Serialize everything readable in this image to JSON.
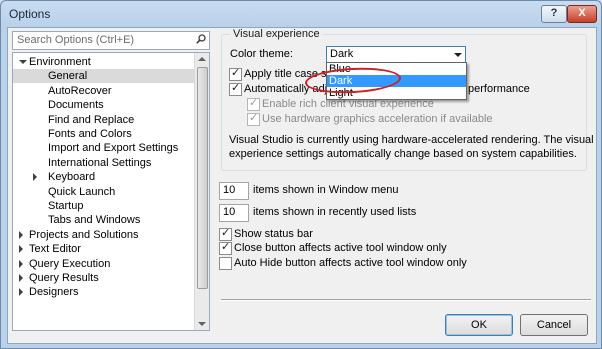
{
  "window": {
    "title": "Options"
  },
  "titlebar": {
    "help_glyph": "?",
    "close_glyph": "X"
  },
  "search": {
    "placeholder": "Search Options (Ctrl+E)",
    "icon": "search-icon"
  },
  "tree": {
    "items": [
      {
        "label": "Environment",
        "expanded": true
      },
      {
        "label": "General",
        "selected": true
      },
      {
        "label": "AutoRecover"
      },
      {
        "label": "Documents"
      },
      {
        "label": "Find and Replace"
      },
      {
        "label": "Fonts and Colors"
      },
      {
        "label": "Import and Export Settings"
      },
      {
        "label": "International Settings"
      },
      {
        "label": "Keyboard",
        "expanded": false
      },
      {
        "label": "Quick Launch"
      },
      {
        "label": "Startup"
      },
      {
        "label": "Tabs and Windows"
      },
      {
        "label": "Projects and Solutions",
        "expanded": false
      },
      {
        "label": "Text Editor",
        "expanded": false
      },
      {
        "label": "Query Execution",
        "expanded": false
      },
      {
        "label": "Query Results",
        "expanded": false
      },
      {
        "label": "Designers",
        "expanded": false
      }
    ]
  },
  "visual_experience": {
    "group_label": "Visual experience",
    "color_theme_label": "Color theme:",
    "color_theme_value": "Dark",
    "dropdown_options": [
      {
        "label": "Blue"
      },
      {
        "label": "Dark",
        "selected": true
      },
      {
        "label": "Light"
      }
    ],
    "apply_title_case": {
      "label_visible": "Apply title case sty",
      "checked": true
    },
    "auto_adjust": {
      "label_start": "Automatically adju",
      "label_end": "performance",
      "checked": true
    },
    "rich_client": {
      "label": "Enable rich client visual experience",
      "checked": true,
      "disabled": true
    },
    "hw_accel": {
      "label": "Use hardware graphics acceleration if available",
      "checked": true,
      "disabled": true
    },
    "info_line1": "Visual Studio is currently using hardware-accelerated rendering. The visual",
    "info_line2": "experience settings automatically change based on system capabilities."
  },
  "window_menu": {
    "value": "10",
    "label": "items shown in Window menu"
  },
  "recent_lists": {
    "value": "10",
    "label": "items shown in recently used lists"
  },
  "show_status_bar": {
    "label": "Show status bar",
    "checked": true
  },
  "close_button": {
    "label": "Close button affects active tool window only",
    "checked": true
  },
  "auto_hide": {
    "label": "Auto Hide button affects active tool window only",
    "checked": false
  },
  "buttons": {
    "ok": "OK",
    "cancel": "Cancel"
  },
  "colors": {
    "accent": "#3399ff",
    "highlight_ring": "#d21d24",
    "selection": "#dadada"
  }
}
